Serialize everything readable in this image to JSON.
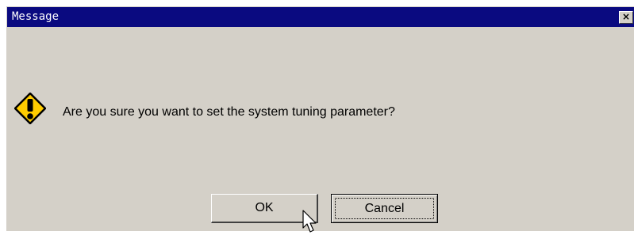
{
  "window": {
    "title": "Message",
    "close_label": "×"
  },
  "dialog": {
    "icon": "warning-icon",
    "message": "Are you sure you want to set the system tuning parameter?"
  },
  "buttons": {
    "ok_label": "OK",
    "cancel_label": "Cancel"
  },
  "colors": {
    "titlebar": "#0a0a80",
    "dialog_bg": "#d4d0c8",
    "warning_fill": "#ffcc00"
  }
}
